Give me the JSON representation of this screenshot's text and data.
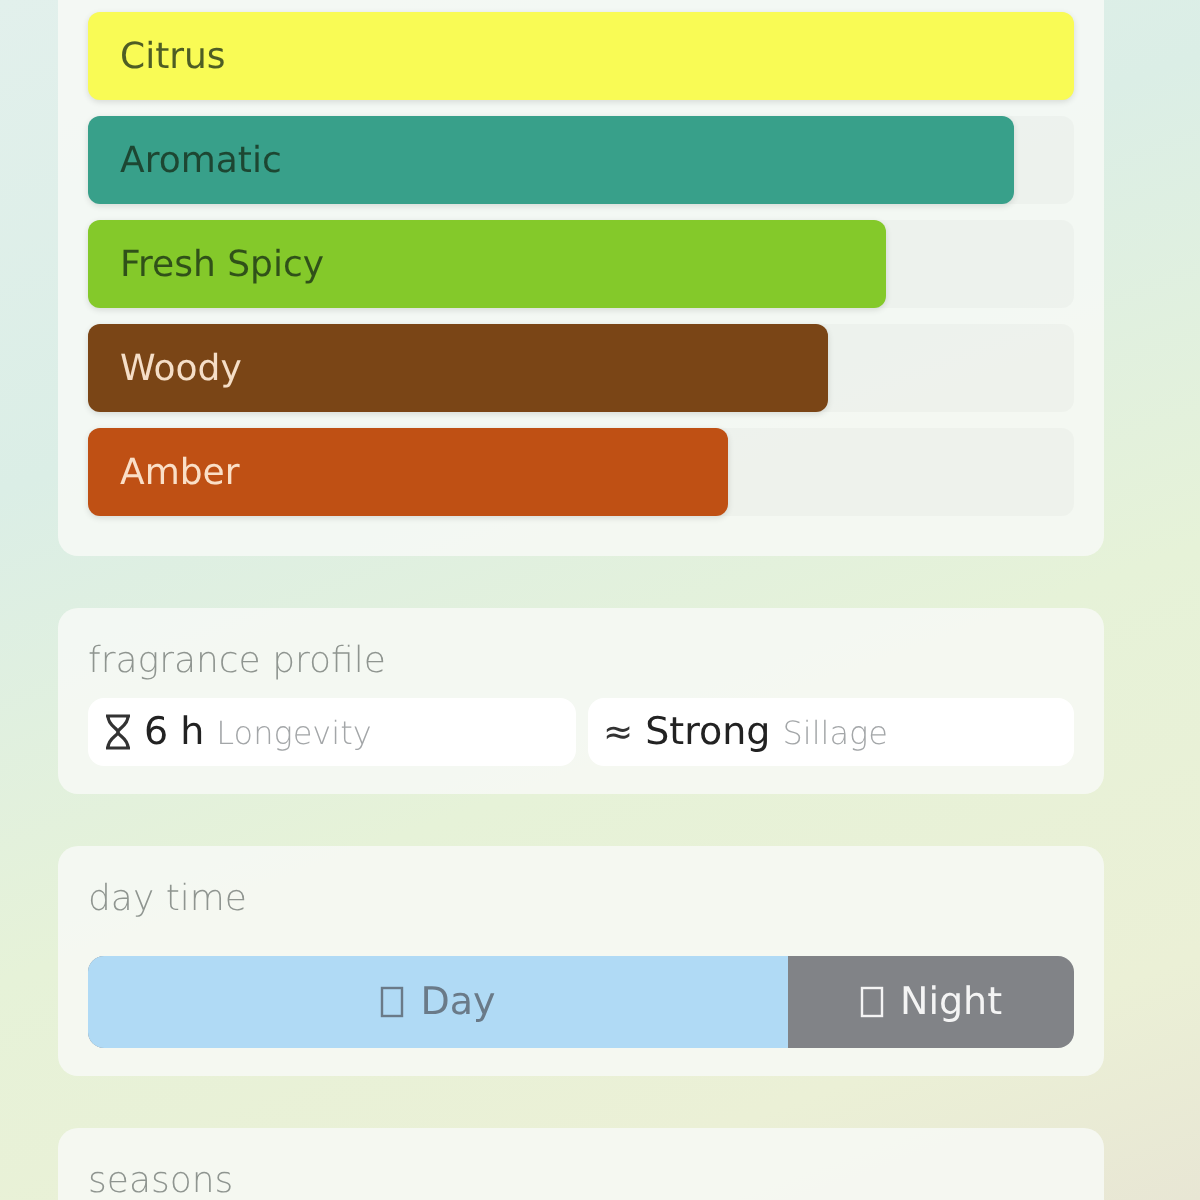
{
  "accords": [
    {
      "name": "Citrus",
      "color": "#f9fb55",
      "level": 1.0
    },
    {
      "name": "Aromatic",
      "color": "#38a08a",
      "level": 0.94
    },
    {
      "name": "Fresh Spicy",
      "color": "#84c92a",
      "level": 0.81
    },
    {
      "name": "Woody",
      "color": "#7a4516",
      "level": 0.75
    },
    {
      "name": "Amber",
      "color": "#bf5014",
      "level": 0.65
    }
  ],
  "profile": {
    "title": "fragrance profile",
    "items": [
      {
        "kind": "longevity",
        "value": "6 h",
        "label": "Longevity"
      },
      {
        "kind": "sillage",
        "icon": "≈",
        "value": "Strong",
        "label": "Sillage"
      }
    ]
  },
  "day_time": {
    "title": "day time",
    "segments": [
      {
        "label": "Day",
        "color": "#b0daf5",
        "level": 0.71
      },
      {
        "label": "Night",
        "color": "#818387"
      }
    ]
  },
  "seasons": {
    "title": "seasons"
  }
}
